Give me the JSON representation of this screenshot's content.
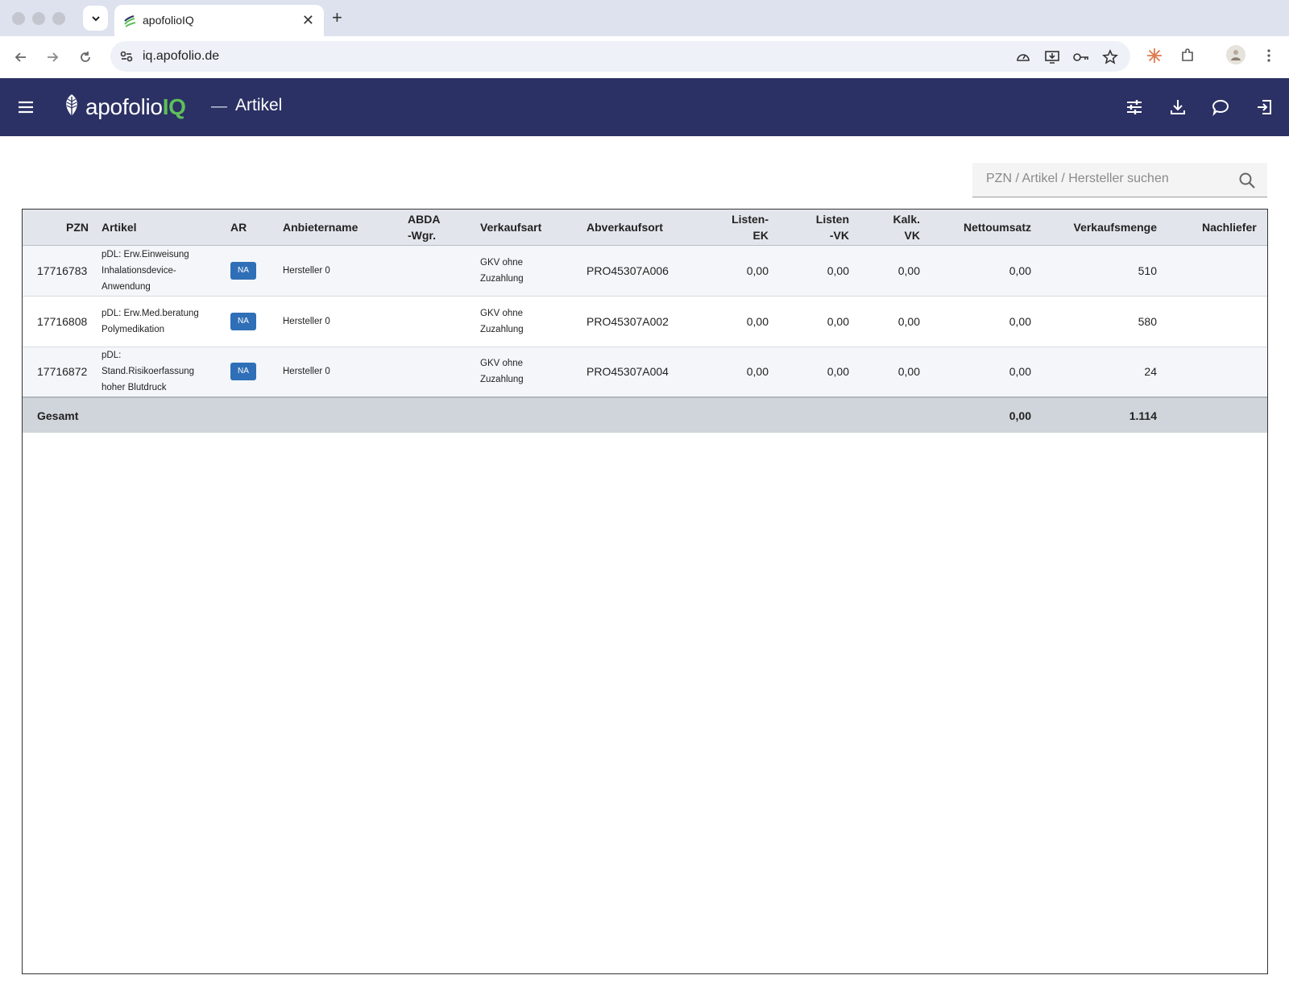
{
  "browser": {
    "tab_title": "apofolioIQ",
    "url": "iq.apofolio.de"
  },
  "app": {
    "logo_text": "apofolio",
    "logo_suffix": "IQ",
    "separator": "—",
    "page_title": "Artikel",
    "accent_color": "#5fbf5a",
    "header_color": "#2b3164"
  },
  "search": {
    "placeholder": "PZN / Artikel / Hersteller suchen"
  },
  "table": {
    "headers": {
      "pzn": "PZN",
      "artikel": "Artikel",
      "ar": "AR",
      "anbieter": "Anbietername",
      "abda": "ABDA\n-Wgr.",
      "verkaufsart": "Verkaufsart",
      "abverkaufsort": "Abverkaufsort",
      "listen_ek": "Listen-\nEK",
      "listen_vk": "Listen\n-VK",
      "kalk_vk": "Kalk.\nVK",
      "nettoumsatz": "Nettoumsatz",
      "verkaufsmenge": "Verkaufsmenge",
      "nachlieferung": "Nachliefer"
    },
    "rows": [
      {
        "pzn": "17716783",
        "artikel": "pDL: Erw.Einweisung Inhalationsdevice-Anwendung",
        "ar": "NA",
        "anbieter": "Hersteller 0",
        "abda": "",
        "verkaufsart": "GKV ohne Zuzahlung",
        "abverkaufsort": "PRO45307A006",
        "listen_ek": "0,00",
        "listen_vk": "0,00",
        "kalk_vk": "0,00",
        "nettoumsatz": "0,00",
        "verkaufsmenge": "510",
        "nachlieferung": ""
      },
      {
        "pzn": "17716808",
        "artikel": "pDL: Erw.Med.beratung Polymedikation",
        "ar": "NA",
        "anbieter": "Hersteller 0",
        "abda": "",
        "verkaufsart": "GKV ohne Zuzahlung",
        "abverkaufsort": "PRO45307A002",
        "listen_ek": "0,00",
        "listen_vk": "0,00",
        "kalk_vk": "0,00",
        "nettoumsatz": "0,00",
        "verkaufsmenge": "580",
        "nachlieferung": ""
      },
      {
        "pzn": "17716872",
        "artikel": "pDL: Stand.Risikoerfassung hoher Blutdruck",
        "ar": "NA",
        "anbieter": "Hersteller 0",
        "abda": "",
        "verkaufsart": "GKV ohne Zuzahlung",
        "abverkaufsort": "PRO45307A004",
        "listen_ek": "0,00",
        "listen_vk": "0,00",
        "kalk_vk": "0,00",
        "nettoumsatz": "0,00",
        "verkaufsmenge": "24",
        "nachlieferung": ""
      }
    ],
    "total": {
      "label": "Gesamt",
      "nettoumsatz": "0,00",
      "verkaufsmenge": "1.114"
    }
  }
}
